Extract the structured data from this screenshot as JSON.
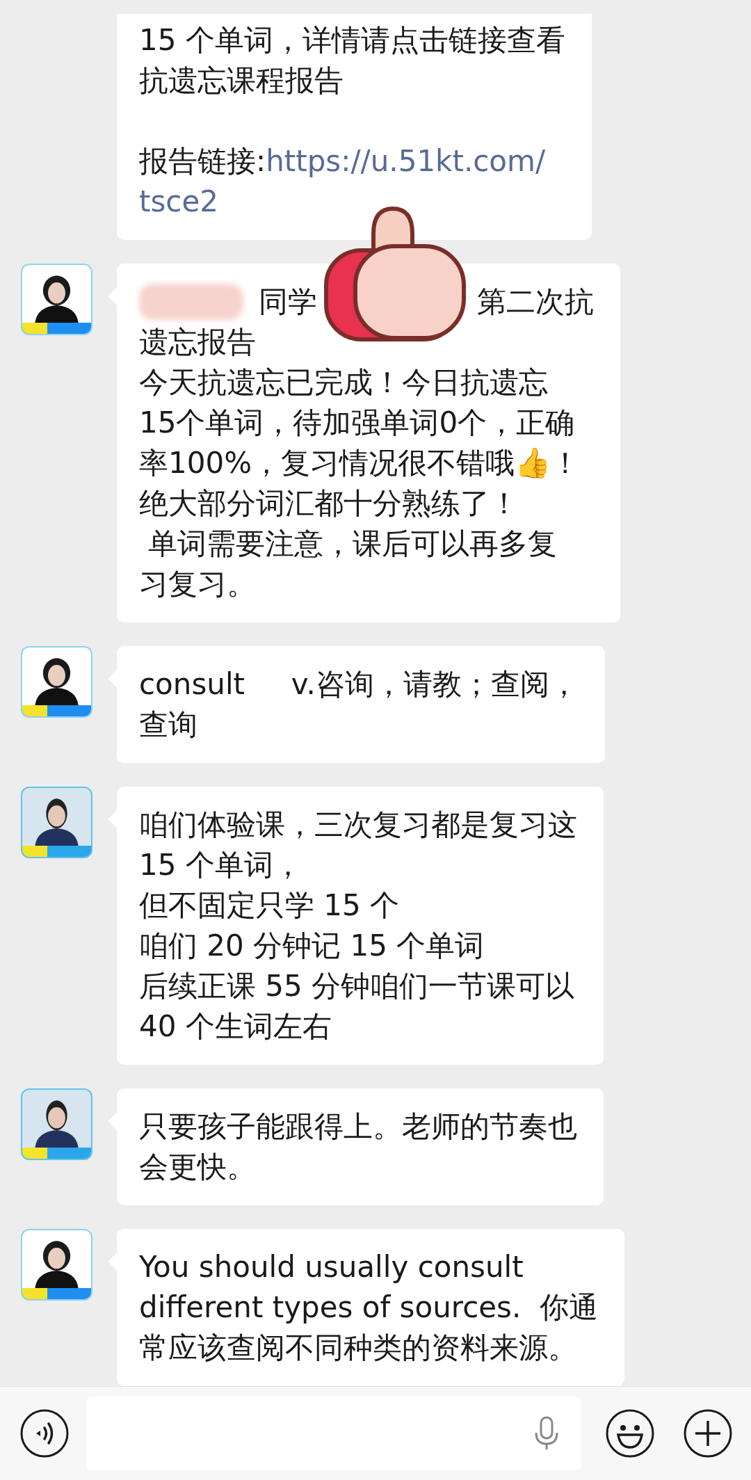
{
  "messages": [
    {
      "paragraphs": [
        [
          "15 个单词，详情请点击链接查看",
          "抗遗忘课程报告"
        ],
        [
          {
            "parts": [
              {
                "kind": "text",
                "text": "报告链接:"
              },
              {
                "kind": "link",
                "text": "https://u.51kt.com/"
              }
            ]
          },
          {
            "parts": [
              {
                "kind": "link",
                "text": "tsce2"
              }
            ]
          }
        ]
      ]
    },
    {
      "avatar": {
        "kind": "coach"
      },
      "sticker": {
        "kind": "thumbs-up"
      },
      "paragraphs": [
        [
          {
            "parts": [
              {
                "kind": "redacted"
              },
              {
                "kind": "text",
                "text": "同学"
              },
              {
                "kind": "covered"
              },
              {
                "kind": "text",
                "text": "第二次抗"
              }
            ]
          },
          "遗忘报告",
          "今天抗遗忘已完成！今日抗遗忘",
          "15个单词，待加强单词0个，正确",
          "率100%，复习情况很不错哦👍！",
          "绝大部分词汇都十分熟练了！",
          " 单词需要注意，课后可以再多复",
          "习复习。"
        ]
      ]
    },
    {
      "avatar": {
        "kind": "coach"
      },
      "paragraphs": [
        [
          "consult     v.咨询，请教；查阅，",
          "查询"
        ]
      ]
    },
    {
      "avatar": {
        "kind": "planner"
      },
      "paragraphs": [
        [
          "咱们体验课，三次复习都是复习这",
          "15 个单词，",
          "但不固定只学 15 个",
          "咱们 20 分钟记 15 个单词",
          "后续正课 55 分钟咱们一节课可以",
          "40 个生词左右"
        ]
      ]
    },
    {
      "avatar": {
        "kind": "planner"
      },
      "paragraphs": [
        [
          "只要孩子能跟得上。老师的节奏也",
          "会更快。"
        ]
      ]
    },
    {
      "avatar": {
        "kind": "coach"
      },
      "paragraphs": [
        [
          "You should usually consult",
          "different types of sources.  你通",
          "常应该查阅不同种类的资料来源。"
        ]
      ]
    }
  ],
  "input_bar": {
    "field": {
      "kind": "mic"
    },
    "buttons": [
      {
        "kind": "voice"
      },
      {
        "kind": "emoji"
      },
      {
        "kind": "add"
      }
    ]
  }
}
